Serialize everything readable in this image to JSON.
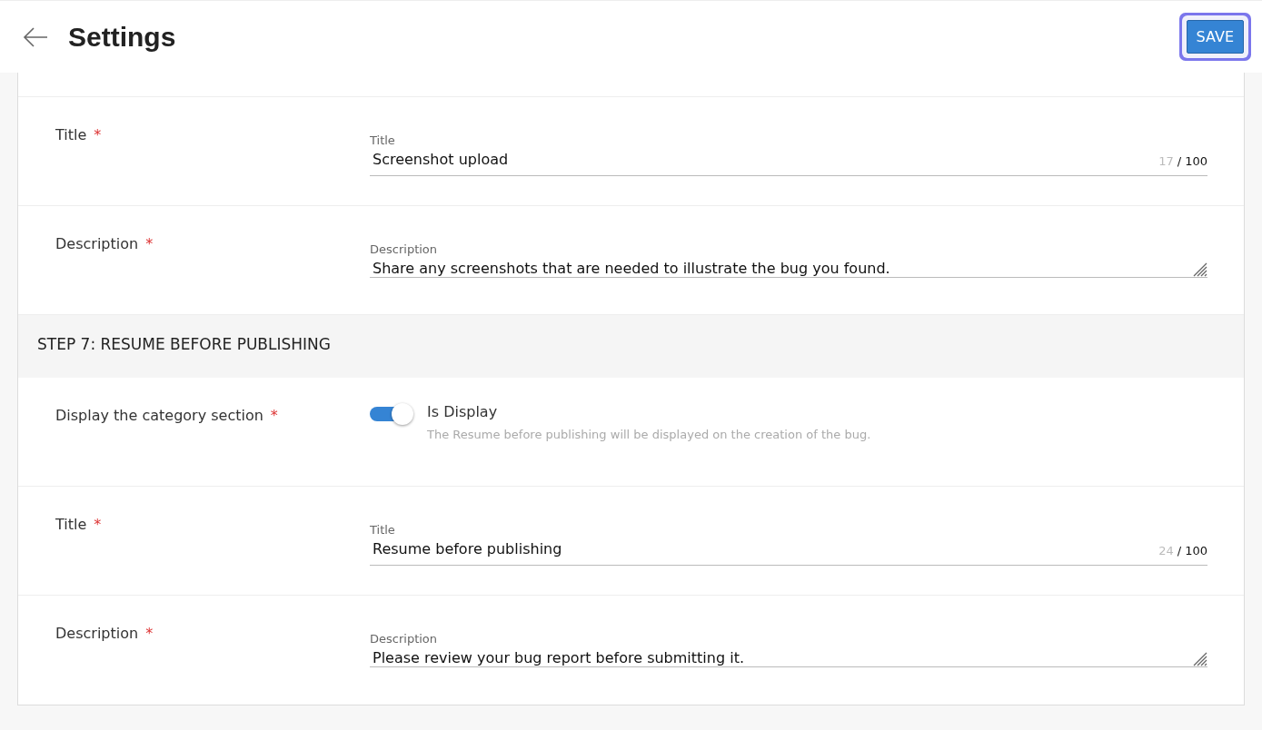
{
  "header": {
    "title": "Settings",
    "save_button": {
      "label": "SAVE",
      "focused": true
    }
  },
  "rows": [
    {
      "kind": "text",
      "label": "Title",
      "required_mark": "*",
      "field_label": "Title",
      "value": "Screenshot upload",
      "counter": {
        "current": "17",
        "separator": "/",
        "max": "100"
      }
    },
    {
      "kind": "textarea",
      "label": "Description",
      "required_mark": "*",
      "field_label": "Description",
      "value": "Share any screenshots that are needed to illustrate the bug you found."
    },
    {
      "kind": "section",
      "label": "STEP 7: RESUME BEFORE PUBLISHING"
    },
    {
      "kind": "toggle",
      "label": "Display the category section",
      "required_mark": "*",
      "toggle_label": "Is Display",
      "on": true,
      "hint": "The Resume before publishing will be displayed on the creation of the bug."
    },
    {
      "kind": "text",
      "label": "Title",
      "required_mark": "*",
      "field_label": "Title",
      "value": "Resume before publishing",
      "counter": {
        "current": "24",
        "separator": "/",
        "max": "100"
      }
    },
    {
      "kind": "textarea",
      "label": "Description",
      "required_mark": "*",
      "field_label": "Description",
      "value": "Please review your bug report before submitting it."
    }
  ]
}
